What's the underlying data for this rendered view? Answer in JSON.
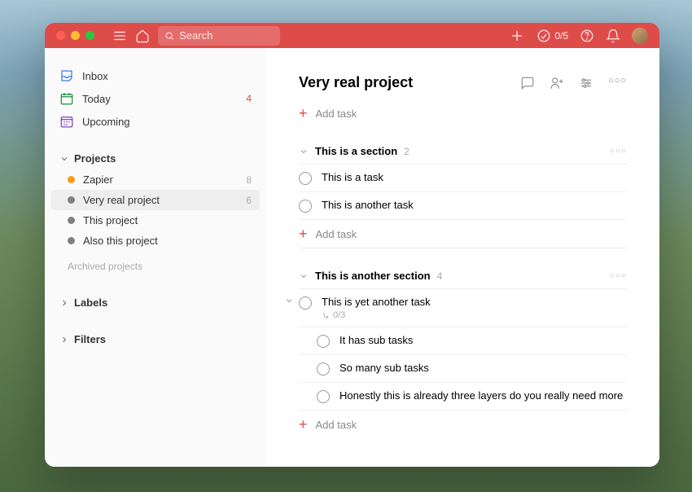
{
  "header": {
    "search_placeholder": "Search",
    "productivity": "0/5"
  },
  "sidebar": {
    "nav": [
      {
        "key": "inbox",
        "label": "Inbox",
        "count": "",
        "color": "#246fe0"
      },
      {
        "key": "today",
        "label": "Today",
        "count": "4",
        "color": "#058527",
        "red": true
      },
      {
        "key": "upcoming",
        "label": "Upcoming",
        "count": "",
        "color": "#692fc2"
      }
    ],
    "projects_label": "Projects",
    "projects": [
      {
        "label": "Zapier",
        "count": "8",
        "dot": "#ff9a14"
      },
      {
        "label": "Very real project",
        "count": "6",
        "dot": "#808080",
        "active": true
      },
      {
        "label": "This project",
        "count": "",
        "dot": "#808080"
      },
      {
        "label": "Also this project",
        "count": "",
        "dot": "#808080"
      }
    ],
    "archived_label": "Archived projects",
    "labels_label": "Labels",
    "filters_label": "Filters"
  },
  "project": {
    "title": "Very real project",
    "add_task": "Add task",
    "sections": [
      {
        "title": "This is a section",
        "count": "2",
        "tasks": [
          {
            "title": "This is a task"
          },
          {
            "title": "This is another task"
          }
        ]
      },
      {
        "title": "This is another section",
        "count": "4",
        "tasks": [
          {
            "title": "This is yet another task",
            "sub_meta": "0/3",
            "expanded": true,
            "subtasks": [
              {
                "title": "It has sub tasks"
              },
              {
                "title": "So many sub tasks"
              },
              {
                "title": "Honestly this is already three layers do you really need more"
              }
            ]
          }
        ]
      }
    ]
  }
}
